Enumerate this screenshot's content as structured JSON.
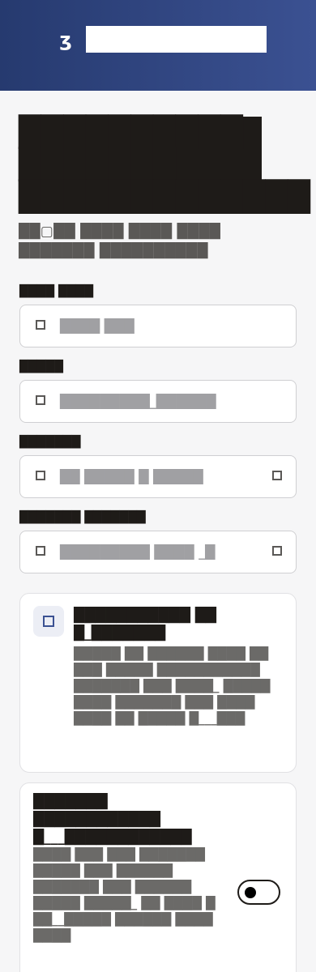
{
  "header": {
    "logo_text": "ʒ",
    "search_placeholder": ""
  },
  "page": {
    "title": "██████████ ███████ █████████████",
    "intro": "██▢██ ████ ████ ████ ███████ ██████████"
  },
  "form": {
    "fields": [
      {
        "label": "████ ████",
        "value": "████ ███"
      },
      {
        "label": "█████",
        "value": "█████████_██████"
      },
      {
        "label": "███████",
        "value": "██ █████ █ █████"
      },
      {
        "label": "███████ ███████",
        "value": "█████████ ████ _█"
      }
    ]
  },
  "cards": [
    {
      "title": "███████████ ██ █_███████",
      "body": "█████ ██ ██████ ████ ██ ███ █████ ███████████ ███████ ███ ████_ █████ ████ ███████ ███ ████ ████ ██ █████ █___███"
    },
    {
      "title": "███████ ████████████ █___████████████",
      "body": "████ ███ ███ ███████ █████ ███ ██████ ███████ ███ ██████ █████ █████_ ██ ████ █ ██__█████ ██████ ████ ████"
    }
  ]
}
